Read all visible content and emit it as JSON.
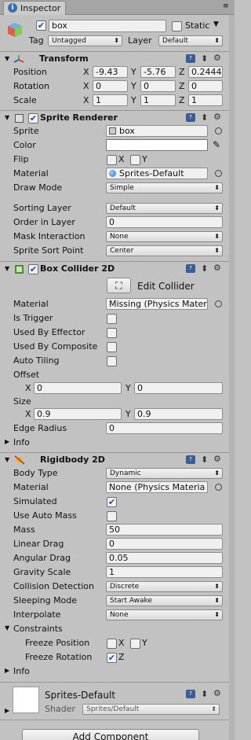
{
  "tab": {
    "title": "Inspector"
  },
  "gameobject": {
    "name": "box",
    "static_label": "Static",
    "tag_label": "Tag",
    "tag_value": "Untagged",
    "layer_label": "Layer",
    "layer_value": "Default"
  },
  "transform": {
    "title": "Transform",
    "position_label": "Position",
    "rotation_label": "Rotation",
    "scale_label": "Scale",
    "axis_x": "X",
    "axis_y": "Y",
    "axis_z": "Z",
    "position": {
      "x": "-9.43",
      "y": "-5.76",
      "z": "0.2444"
    },
    "rotation": {
      "x": "0",
      "y": "0",
      "z": "0"
    },
    "scale": {
      "x": "1",
      "y": "1",
      "z": "1"
    }
  },
  "sprite_renderer": {
    "title": "Sprite Renderer",
    "sprite_label": "Sprite",
    "sprite_value": "box",
    "color_label": "Color",
    "flip_label": "Flip",
    "flip_x": "X",
    "flip_y": "Y",
    "material_label": "Material",
    "material_value": "Sprites-Default",
    "draw_mode_label": "Draw Mode",
    "draw_mode_value": "Simple",
    "sorting_layer_label": "Sorting Layer",
    "sorting_layer_value": "Default",
    "order_label": "Order in Layer",
    "order_value": "0",
    "mask_label": "Mask Interaction",
    "mask_value": "None",
    "sort_point_label": "Sprite Sort Point",
    "sort_point_value": "Center"
  },
  "box_collider": {
    "title": "Box Collider 2D",
    "edit_collider_label": "Edit Collider",
    "material_label": "Material",
    "material_value": "Missing (Physics Mater",
    "is_trigger_label": "Is Trigger",
    "used_by_effector_label": "Used By Effector",
    "used_by_composite_label": "Used By Composite",
    "auto_tiling_label": "Auto Tiling",
    "offset_label": "Offset",
    "offset_x": "0",
    "offset_y": "0",
    "size_label": "Size",
    "size_x": "0.9",
    "size_y": "0.9",
    "axis_x": "X",
    "axis_y": "Y",
    "edge_radius_label": "Edge Radius",
    "edge_radius_value": "0",
    "info_label": "Info"
  },
  "rigidbody": {
    "title": "Rigidbody 2D",
    "body_type_label": "Body Type",
    "body_type_value": "Dynamic",
    "material_label": "Material",
    "material_value": "None (Physics Materia",
    "simulated_label": "Simulated",
    "auto_mass_label": "Use Auto Mass",
    "mass_label": "Mass",
    "mass_value": "50",
    "linear_drag_label": "Linear Drag",
    "linear_drag_value": "0",
    "angular_drag_label": "Angular Drag",
    "angular_drag_value": "0.05",
    "gravity_label": "Gravity Scale",
    "gravity_value": "1",
    "collision_label": "Collision Detection",
    "collision_value": "Discrete",
    "sleeping_label": "Sleeping Mode",
    "sleeping_value": "Start Awake",
    "interpolate_label": "Interpolate",
    "interpolate_value": "None",
    "constraints_label": "Constraints",
    "freeze_pos_label": "Freeze Position",
    "freeze_x": "X",
    "freeze_y": "Y",
    "freeze_rot_label": "Freeze Rotation",
    "freeze_z": "Z",
    "info_label": "Info"
  },
  "material_preview": {
    "name": "Sprites-Default",
    "shader_label": "Shader",
    "shader_value": "Sprites/Default"
  },
  "footer": {
    "add_component_label": "Add Component"
  },
  "glyphs": {
    "check": "✔",
    "arrow_up_down": "⬍",
    "gear": "✱",
    "settings": "⚙",
    "fold_open": "▼",
    "fold_closed": "▶",
    "dropdown": "▾",
    "pipette": "✎",
    "edit_collider": "⛶"
  }
}
